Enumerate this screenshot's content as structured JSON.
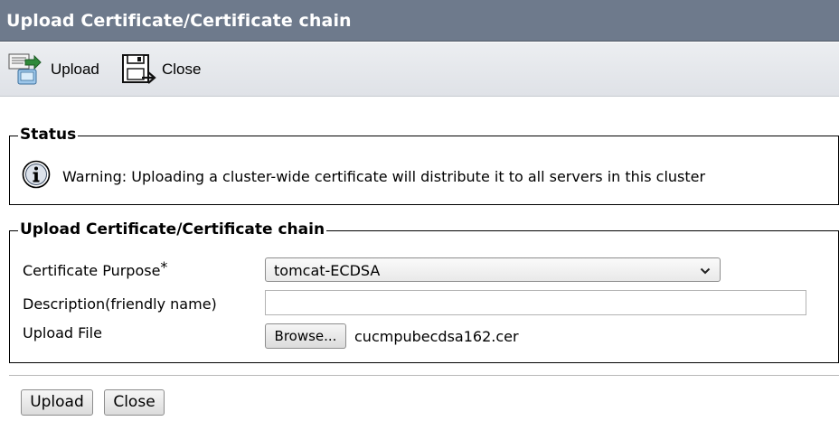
{
  "window": {
    "title": "Upload Certificate/Certificate chain"
  },
  "toolbar": {
    "upload_label": "Upload",
    "close_label": "Close"
  },
  "status": {
    "legend": "Status",
    "icon": "info-icon",
    "message": "Warning: Uploading a cluster-wide certificate will distribute it to all servers in this cluster"
  },
  "form": {
    "legend": "Upload Certificate/Certificate chain",
    "purpose_label": "Certificate Purpose",
    "required_marker": "*",
    "purpose_value": "tomcat-ECDSA",
    "description_label": "Description(friendly name)",
    "description_value": "",
    "file_label": "Upload File",
    "browse_label": "Browse...",
    "file_name": "cucmpubecdsa162.cer"
  },
  "footer": {
    "upload_label": "Upload",
    "close_label": "Close"
  },
  "colors": {
    "title_bar": "#6e7a8c",
    "toolbar": "#e4e7eb"
  }
}
